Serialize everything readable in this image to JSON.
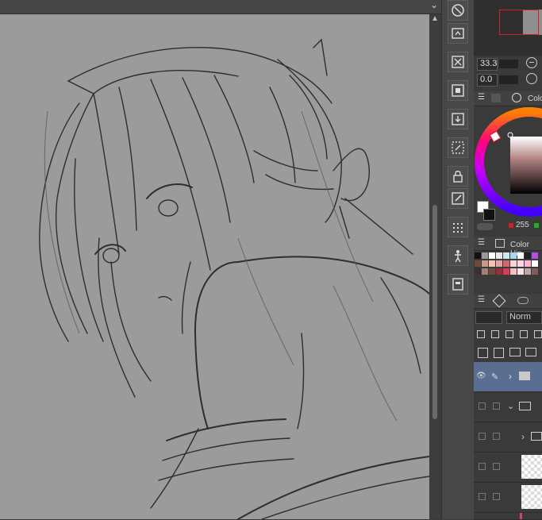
{
  "navigator": {
    "zoom": "33.3",
    "angle": "0.0"
  },
  "color_wheel": {
    "tab_label": "Color",
    "value_r": "255"
  },
  "color_history": {
    "tab_label": "Color His"
  },
  "layers": {
    "blend_mode": "Norm"
  },
  "colors": {
    "canvas_bg": "#9b9b9b",
    "line": "#2e2e2e",
    "panel": "#3a3a3a",
    "selected_layer": "#5a6e92"
  },
  "swatches": [
    "#111111",
    "#9a9a9a",
    "#ffffff",
    "#e8e8e8",
    "#cfe7f5",
    "#a7d7f2",
    "#ffffff",
    "#222222",
    "#b14fe0",
    "#6d4a3a",
    "#c79a86",
    "#f4c1b5",
    "#e8a2a2",
    "#d06a6a",
    "#f3d7d7",
    "#ffd7e2",
    "#ffb5cf",
    "#ffffff",
    "#3c2f2f",
    "#a08070",
    "#6a4b3d",
    "#9a2b3a",
    "#d93a54",
    "#f2c0c8",
    "#ffe1e8",
    "#c2a4a4",
    "#7d5e5e"
  ]
}
